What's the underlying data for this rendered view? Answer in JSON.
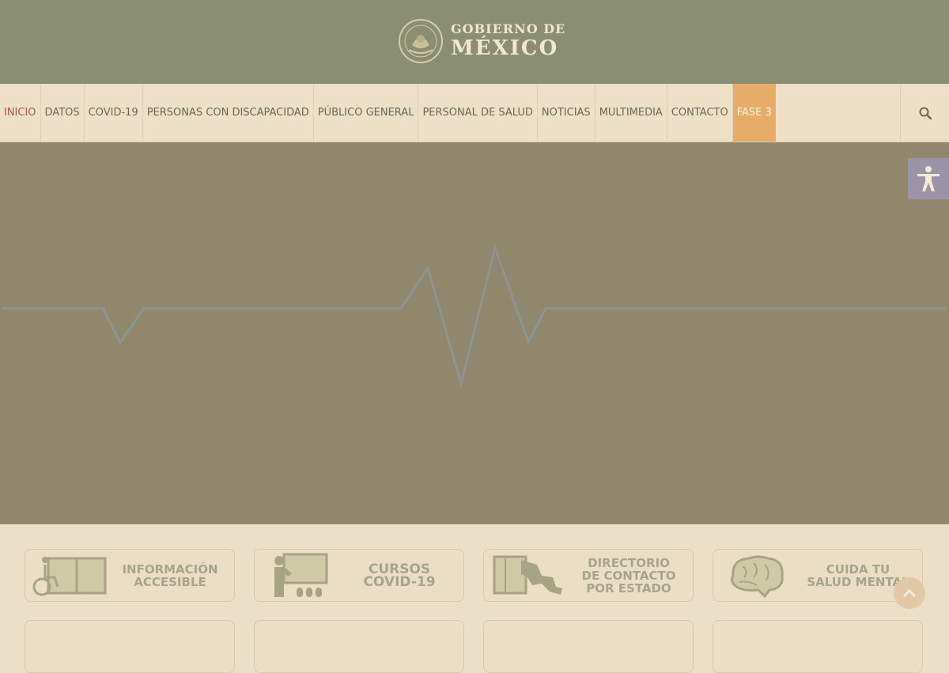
{
  "header": {
    "logo_line1": "GOBIERNO DE",
    "logo_line2": "MÉXICO",
    "seal_icon": "coat-of-arms-seal"
  },
  "nav": {
    "items": [
      {
        "label": "INICIO",
        "state": "active"
      },
      {
        "label": "DATOS"
      },
      {
        "label": "COVID-19"
      },
      {
        "label": "PERSONAS CON DISCAPACIDAD"
      },
      {
        "label": "PÚBLICO GENERAL"
      },
      {
        "label": "PERSONAL DE SALUD"
      },
      {
        "label": "NOTICIAS"
      },
      {
        "label": "MULTIMEDIA"
      },
      {
        "label": "CONTACTO"
      },
      {
        "label": "FASE 3",
        "state": "highlighted"
      }
    ],
    "search_icon": "search-icon"
  },
  "hero": {
    "graphic": "heartbeat-line",
    "background_color": "#91876c",
    "line_color": "#8b9594"
  },
  "accessibility_button_icon": "accessibility-person-icon",
  "cards": [
    {
      "lines": [
        "INFORMACIÓN",
        "ACCESIBLE"
      ],
      "icon": "wheelchair-book-icon"
    },
    {
      "lines": [
        "CURSOS COVID-19"
      ],
      "icon": "teacher-board-icon"
    },
    {
      "lines": [
        "DIRECTORIO",
        "DE CONTACTO",
        "POR ESTADO"
      ],
      "icon": "directory-map-icon"
    },
    {
      "lines": [
        "CUIDA TU",
        "SALUD MENTAL"
      ],
      "icon": "brain-icon"
    }
  ],
  "scroll_top_icon": "chevron-up-icon",
  "colors": {
    "header_bg": "#8a8f73",
    "nav_bg": "#ede0c6",
    "active_nav": "#a05a45",
    "highlight_nav": "#e6ad6a",
    "card_text": "#a4a58d"
  }
}
